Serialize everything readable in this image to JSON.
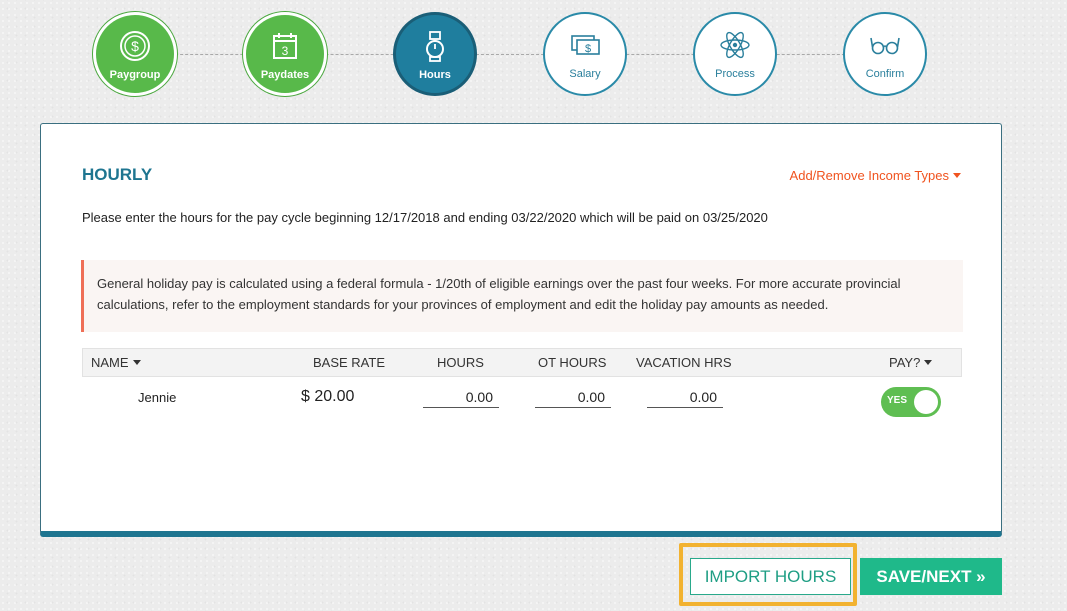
{
  "steps": [
    {
      "label": "Paygroup",
      "icon": "dollar-coin-icon",
      "state": "done"
    },
    {
      "label": "Paydates",
      "icon": "calendar-icon",
      "state": "done"
    },
    {
      "label": "Hours",
      "icon": "stopwatch-icon",
      "state": "active"
    },
    {
      "label": "Salary",
      "icon": "money-bills-icon",
      "state": "todo"
    },
    {
      "label": "Process",
      "icon": "atom-icon",
      "state": "todo"
    },
    {
      "label": "Confirm",
      "icon": "glasses-icon",
      "state": "todo"
    }
  ],
  "calendar_day": "3",
  "section": {
    "title": "HOURLY",
    "add_remove": "Add/Remove Income Types",
    "intro": "Please enter the hours for the pay cycle beginning 12/17/2018 and ending 03/22/2020 which will be paid on 03/25/2020",
    "notice": "General holiday pay is calculated using a federal formula - 1/20th of eligible earnings over the past four weeks. For more accurate provincial calculations, refer to the employment standards for your provinces of employment and edit the holiday pay amounts as needed."
  },
  "table": {
    "headers": {
      "name": "NAME",
      "base_rate": "BASE RATE",
      "hours": "HOURS",
      "ot_hours": "OT HOURS",
      "vacation_hrs": "VACATION HRS",
      "pay": "PAY?"
    },
    "rows": [
      {
        "name": "Jennie",
        "base_rate": "$ 20.00",
        "hours": "0.00",
        "ot_hours": "0.00",
        "vacation_hrs": "0.00",
        "pay": "YES"
      }
    ]
  },
  "buttons": {
    "import": "IMPORT HOURS",
    "save_next": "SAVE/NEXT »"
  },
  "colors": {
    "done": "#58b94a",
    "active": "#1f7e9e",
    "accent_orange": "#f0531f",
    "highlight": "#f2b230",
    "save_button": "#1fb98a"
  }
}
